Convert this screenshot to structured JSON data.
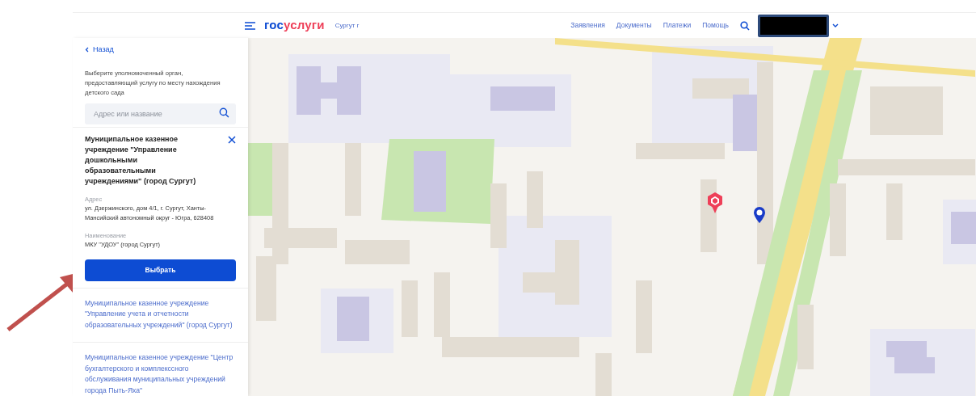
{
  "header": {
    "logo": {
      "first": "гос",
      "second": "услуги"
    },
    "city": "Сургут г",
    "nav": [
      {
        "label": "Заявления"
      },
      {
        "label": "Документы"
      },
      {
        "label": "Платежи"
      },
      {
        "label": "Помощь"
      }
    ]
  },
  "panel": {
    "back": "Назад",
    "description": "Выберите уполномоченный орган, предоставляющий услугу по месту нахождения детского сада",
    "search": {
      "placeholder": "Адрес или название"
    },
    "selected": {
      "title": "Муниципальное казенное учреждение \"Управление дошкольными образовательными учреждениями\" (город Сургут)",
      "fields": [
        {
          "label": "Адрес",
          "value": "ул. Дзержинского, дом 4/1, г. Сургут, Ханты-Мансийский автономный округ - Югра, 628408"
        },
        {
          "label": "Наименование",
          "value": "МКУ \"УДОУ\" (город Сургут)"
        }
      ],
      "button": "Выбрать"
    },
    "items": [
      {
        "text": "Муниципальное казенное учреждение \"Управление учета и отчетности образовательных учреждений\" (город Сургут)"
      },
      {
        "text": "Муниципальное казенное учреждение \"Центр бухгалтерского и комплекссного обслуживания муниципальных учреждений города Пыть-Яха\""
      }
    ]
  }
}
